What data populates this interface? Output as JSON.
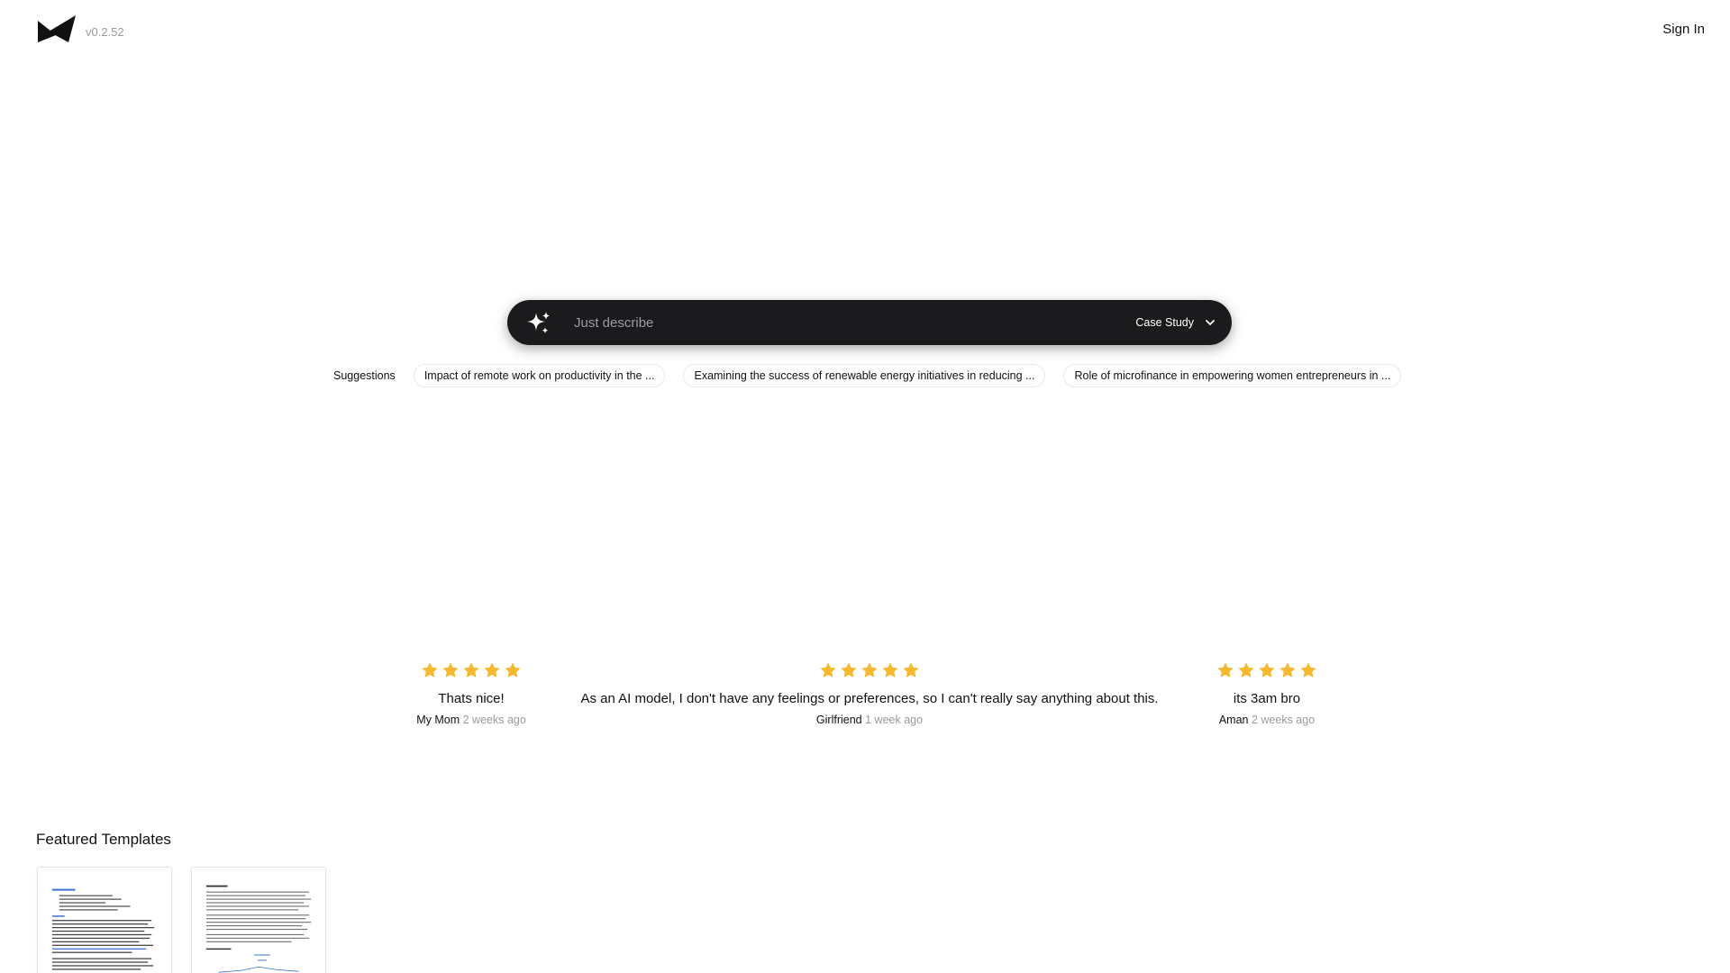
{
  "header": {
    "version": "v0.2.52",
    "sign_in_label": "Sign In"
  },
  "prompt": {
    "placeholder": "Just describe",
    "value": "",
    "type_label": "Case Study"
  },
  "suggestions": {
    "label": "Suggestions",
    "items": [
      "Impact of remote work on productivity in the ...",
      "Examining the success of renewable energy initiatives in reducing ...",
      "Role of microfinance in empowering women entrepreneurs in ..."
    ]
  },
  "reviews": [
    {
      "rating": 5,
      "text": "Thats nice!",
      "author": "My Mom",
      "time": "2 weeks ago"
    },
    {
      "rating": 5,
      "text": "As an AI model, I don't have any feelings or preferences, so I can't really say anything about this.",
      "author": "Girlfriend",
      "time": "1 week ago"
    },
    {
      "rating": 5,
      "text": "its 3am bro",
      "author": "Aman",
      "time": "2 weeks ago"
    }
  ],
  "featured": {
    "title": "Featured Templates"
  },
  "icons": {
    "logo": "bowtie-logo-icon",
    "prompt": "sparkle-icon",
    "dropdown": "chevron-down-icon",
    "rating": "star-icon"
  },
  "colors": {
    "prompt_bar": "#1b1b1d",
    "star": "#f5b82e",
    "muted_text": "#9a9a9a",
    "link_blue": "#3b6fd4"
  }
}
